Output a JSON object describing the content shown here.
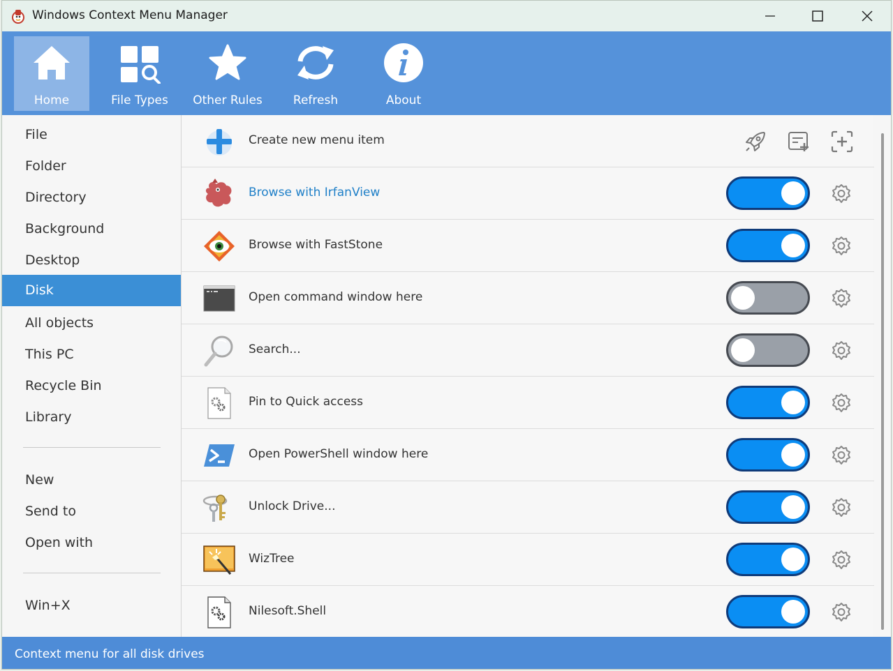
{
  "window": {
    "title": "Windows Context Menu Manager"
  },
  "toolbar": {
    "home": "Home",
    "file_types": "File Types",
    "other_rules": "Other Rules",
    "refresh": "Refresh",
    "about": "About"
  },
  "sidebar": {
    "items": [
      "File",
      "Folder",
      "Directory",
      "Background",
      "Desktop",
      "Disk",
      "All objects",
      "This PC",
      "Recycle Bin",
      "Library"
    ],
    "items2": [
      "New",
      "Send to",
      "Open with"
    ],
    "items3": [
      "Win+X"
    ],
    "active": "Disk"
  },
  "main": {
    "create_label": "Create new menu item",
    "rows": [
      {
        "label": "Browse with IrfanView",
        "enabled": true,
        "icon": "irfanview-icon"
      },
      {
        "label": "Browse with FastStone",
        "enabled": true,
        "icon": "faststone-icon"
      },
      {
        "label": "Open command window here",
        "enabled": false,
        "icon": "cmd-icon"
      },
      {
        "label": "Search...",
        "enabled": false,
        "icon": "magnifier-icon"
      },
      {
        "label": "Pin to Quick access",
        "enabled": true,
        "icon": "settings-file-icon"
      },
      {
        "label": "Open PowerShell window here",
        "enabled": true,
        "icon": "powershell-icon"
      },
      {
        "label": "Unlock Drive...",
        "enabled": true,
        "icon": "keys-icon"
      },
      {
        "label": "WizTree",
        "enabled": true,
        "icon": "wiztree-icon"
      },
      {
        "label": "Nilesoft.Shell",
        "enabled": true,
        "icon": "settings-file-icon"
      }
    ]
  },
  "statusbar": {
    "text": "Context menu for all disk drives"
  },
  "colors": {
    "toolbar": "#5592da",
    "active_item": "#3b8fd6",
    "toggle_on": "#0a8ef3",
    "toggle_off": "#9aa0a8"
  }
}
